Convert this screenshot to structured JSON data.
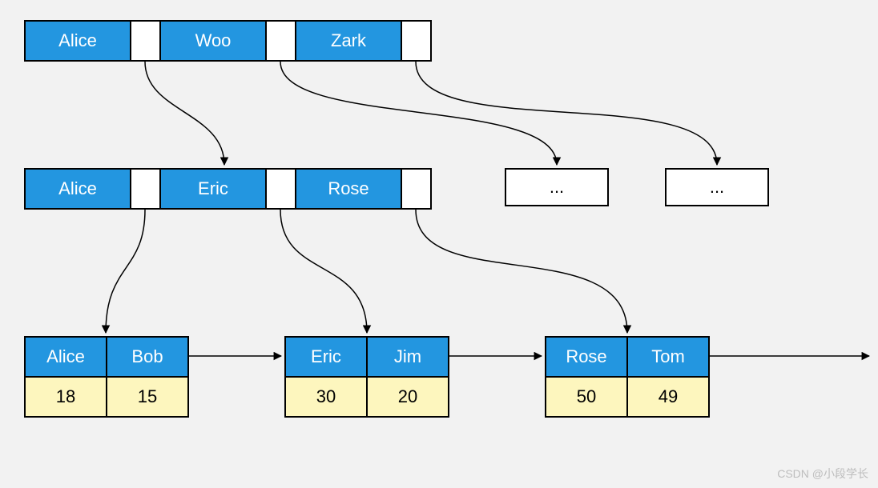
{
  "root": {
    "keys": [
      "Alice",
      "Woo",
      "Zark"
    ]
  },
  "level1": {
    "node0": {
      "keys": [
        "Alice",
        "Eric",
        "Rose"
      ]
    },
    "node1": {
      "label": "..."
    },
    "node2": {
      "label": "..."
    }
  },
  "leaves": {
    "leaf0": {
      "keys": [
        "Alice",
        "Bob"
      ],
      "values": [
        "18",
        "15"
      ]
    },
    "leaf1": {
      "keys": [
        "Eric",
        "Jim"
      ],
      "values": [
        "30",
        "20"
      ]
    },
    "leaf2": {
      "keys": [
        "Rose",
        "Tom"
      ],
      "values": [
        "50",
        "49"
      ]
    }
  },
  "watermark": "CSDN @小段学长"
}
